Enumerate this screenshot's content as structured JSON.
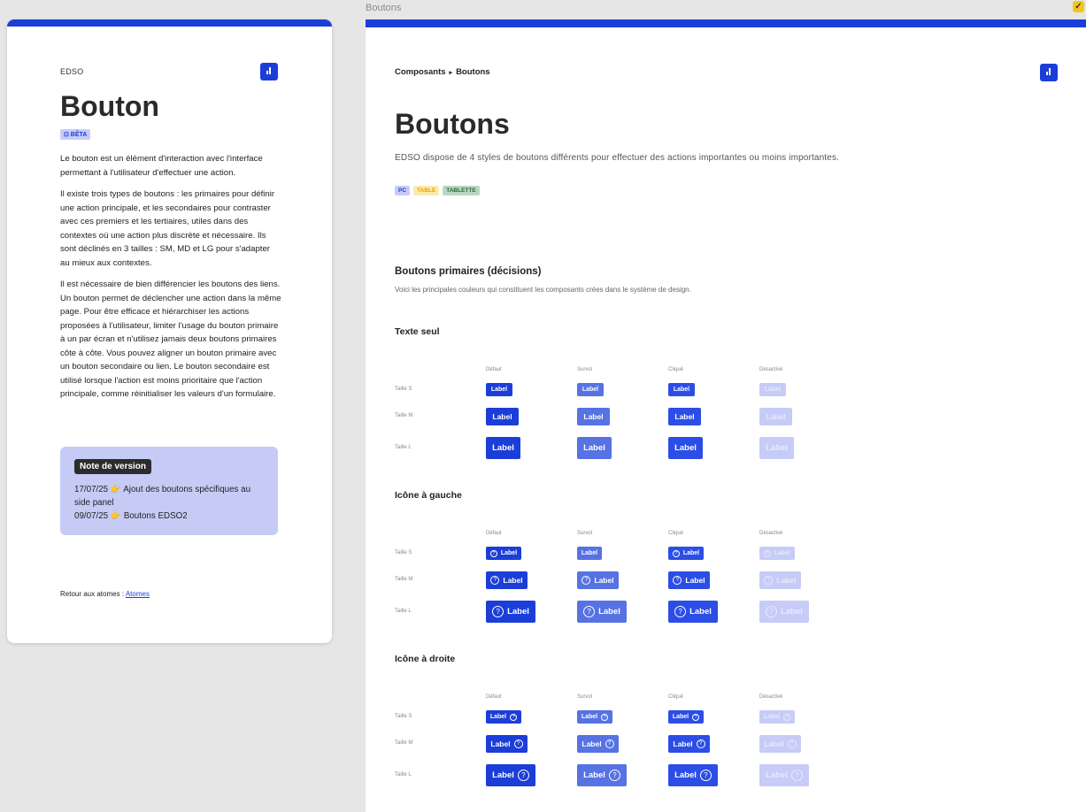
{
  "canvas": {
    "frame_label": "Boutons",
    "badge": "✓"
  },
  "left_card": {
    "brand": "EDSO",
    "title": "Bouton",
    "beta": "⊡ BÊTA",
    "paragraphs": [
      "Le bouton est un élément d'interaction avec l'interface permettant à l'utilisateur d'effectuer une action.",
      "Il existe trois types de boutons : les primaires pour définir une action principale, et les secondaires pour contraster avec ces premiers et les tertiaires, utiles dans des contextes où une action plus discrète et nécessaire. Ils sont déclinés en 3 tailles : SM, MD et LG pour s'adapter au mieux aux contextes.",
      "Il est nécessaire de bien différencier les boutons des liens. Un bouton permet de déclencher une action dans la même page. Pour être efficace et hiérarchiser les actions proposées à l'utilisateur, limiter l'usage du bouton primaire à un par écran et n'utilisez jamais deux boutons primaires côte à côte. Vous pouvez aligner un bouton primaire avec un bouton secondaire ou lien. Le bouton secondaire est utilisé lorsque l'action est moins prioritaire que l'action principale, comme réinitialiser les valeurs d'un formulaire."
    ],
    "note": {
      "title": "Note de version",
      "entries": [
        {
          "date": "17/07/25",
          "text": "Ajout des boutons spécifiques au side panel"
        },
        {
          "date": "09/07/25",
          "text": "Boutons EDSO2"
        }
      ],
      "arrow": "👉"
    },
    "back_prefix": "Retour aux atomes : ",
    "back_link": "Atomes"
  },
  "panel": {
    "breadcrumb": {
      "parent": "Composants",
      "sep": "▸",
      "current": "Boutons"
    },
    "title": "Boutons",
    "subtitle": "EDSO dispose de 4 styles de boutons différents pour effectuer des actions importantes ou moins importantes.",
    "tags": [
      "PC",
      "TABLE",
      "TABLETTE"
    ],
    "section_title": "Boutons primaires (décisions)",
    "section_sub": "Voici les principales couleurs qui constituent les composants crées dans le système de design.",
    "columns": [
      "Défaut",
      "Survol",
      "Cliqué",
      "Désactivé"
    ],
    "rows": [
      "Taille S",
      "Taille M",
      "Taille L"
    ],
    "button_label": "Label",
    "help_glyph": "?",
    "blocks": [
      "Texte seul",
      "Icône à gauche",
      "Icône à droite"
    ]
  },
  "colors": {
    "primary": "#1c3ed8",
    "hover": "#5672e3",
    "clicked": "#2c4ee6",
    "disabled": "#c6ccf7",
    "note_bg": "#c6cbf6"
  }
}
